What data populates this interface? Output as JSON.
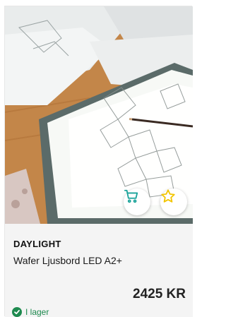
{
  "product": {
    "brand": "DAYLIGHT",
    "name": "Wafer Ljusbord LED A2+",
    "price": "2425 KR",
    "stock_status": "I lager",
    "image_icon": "lightbox-photo",
    "cart_icon": "shopping-cart-icon",
    "favorite_icon": "star-icon"
  },
  "colors": {
    "accent_green": "#1e8a4f",
    "cart_teal": "#1aa39a",
    "star_yellow": "#f2c500",
    "info_bg": "#f4f4f4"
  }
}
